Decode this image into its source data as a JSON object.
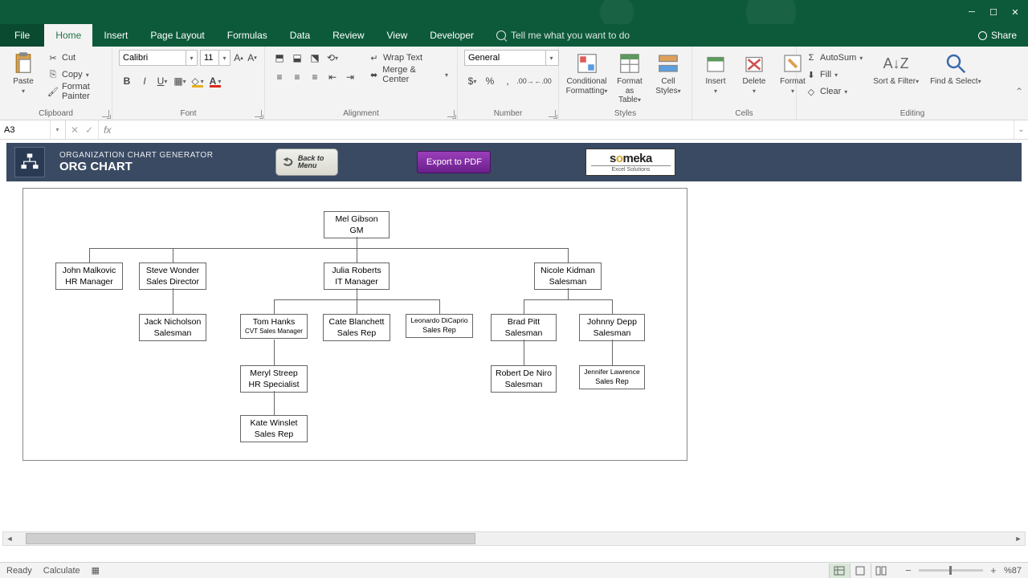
{
  "window": {
    "share": "Share"
  },
  "tabs": {
    "file": "File",
    "home": "Home",
    "insert": "Insert",
    "pageLayout": "Page Layout",
    "formulas": "Formulas",
    "data": "Data",
    "review": "Review",
    "view": "View",
    "developer": "Developer",
    "tellme": "Tell me what you want to do"
  },
  "ribbon": {
    "clipboard": {
      "paste": "Paste",
      "cut": "Cut",
      "copy": "Copy",
      "formatPainter": "Format Painter",
      "label": "Clipboard"
    },
    "font": {
      "name": "Calibri",
      "size": "11",
      "label": "Font"
    },
    "alignment": {
      "wrap": "Wrap Text",
      "merge": "Merge & Center",
      "label": "Alignment"
    },
    "number": {
      "format": "General",
      "label": "Number"
    },
    "styles": {
      "conditional": "Conditional Formatting",
      "table": "Format as Table",
      "cell": "Cell Styles",
      "label": "Styles"
    },
    "cells": {
      "insert": "Insert",
      "delete": "Delete",
      "format": "Format",
      "label": "Cells"
    },
    "editing": {
      "autosum": "AutoSum",
      "fill": "Fill",
      "clear": "Clear",
      "sort": "Sort & Filter",
      "find": "Find & Select",
      "label": "Editing"
    }
  },
  "formulaBar": {
    "nameBox": "A3",
    "fx": "fx"
  },
  "orgHeader": {
    "subtitle": "ORGANIZATION CHART GENERATOR",
    "title": "ORG CHART",
    "back": "Back to Menu",
    "export": "Export to PDF",
    "brand": "someka",
    "brandSub": "Excel Solutions"
  },
  "chart_data": {
    "type": "org-chart",
    "root": {
      "name": "Mel Gibson",
      "role": "GM"
    },
    "level2": [
      {
        "name": "John Malkovic",
        "role": "HR Manager"
      },
      {
        "name": "Steve Wonder",
        "role": "Sales Director"
      },
      {
        "name": "Julia Roberts",
        "role": "IT Manager"
      },
      {
        "name": "Nicole Kidman",
        "role": "Salesman"
      }
    ],
    "under_steve": [
      {
        "name": "Jack Nicholson",
        "role": "Salesman"
      }
    ],
    "under_julia": [
      {
        "name": "Tom Hanks",
        "role": "CVT Sales Manager"
      },
      {
        "name": "Cate Blanchett",
        "role": "Sales Rep"
      },
      {
        "name": "Leonardo DiCaprio",
        "role": "Sales Rep"
      }
    ],
    "under_nicole": [
      {
        "name": "Brad Pitt",
        "role": "Salesman"
      },
      {
        "name": "Johnny Depp",
        "role": "Salesman"
      }
    ],
    "under_tom": [
      {
        "name": "Meryl Streep",
        "role": "HR Specialist"
      }
    ],
    "under_meryl": [
      {
        "name": "Kate Winslet",
        "role": "Sales Rep"
      }
    ],
    "under_brad": [
      {
        "name": "Robert De Niro",
        "role": "Salesman"
      }
    ],
    "under_johnny": [
      {
        "name": "Jennifer Lawrence",
        "role": "Sales Rep"
      }
    ]
  },
  "status": {
    "ready": "Ready",
    "calculate": "Calculate",
    "zoom": "%87"
  }
}
